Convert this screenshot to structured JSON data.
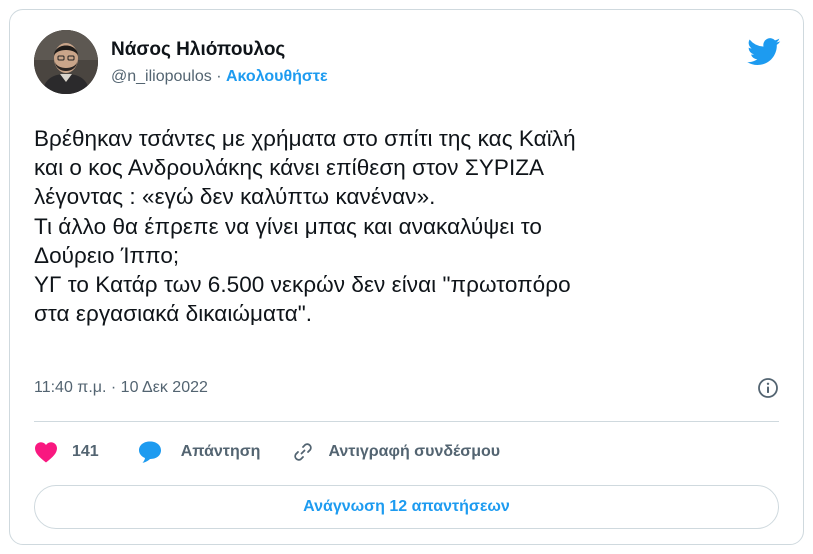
{
  "author": {
    "display_name": "Νάσος Ηλιόπουλος",
    "handle": "@n_iliopoulos",
    "separator": "·",
    "follow_label": "Ακολουθήστε"
  },
  "tweet": {
    "text": "Βρέθηκαν τσάντες με χρήματα στο σπίτι της κας Καϊλή\nκαι ο κος Ανδρουλάκης κάνει επίθεση στον ΣΥΡΙΖΑ\nλέγοντας : «εγώ δεν καλύπτω κανέναν».\nΤι άλλο θα έπρεπε να γίνει μπας και ανακαλύψει το\nΔούρειο Ίππο;\nΥΓ το Κατάρ των 6.500 νεκρών δεν είναι \"πρωτοπόρο\nστα εργασιακά δικαιώματα\".",
    "timestamp": "11:40 π.μ. · 10 Δεκ 2022"
  },
  "actions": {
    "like_count": "141",
    "reply_label": "Απάντηση",
    "copy_link_label": "Αντιγραφή συνδέσμου"
  },
  "read_replies_label": "Ανάγνωση 12 απαντήσεων",
  "icons": {
    "brand": "twitter-bird-icon",
    "info": "info-icon",
    "like": "heart-icon",
    "reply": "speech-bubble-icon",
    "copy": "link-icon"
  },
  "colors": {
    "twitter_blue": "#1d9bf0",
    "like_pink": "#f91880",
    "text_primary": "#0f1419",
    "text_secondary": "#536471",
    "border": "#cfd9de"
  }
}
